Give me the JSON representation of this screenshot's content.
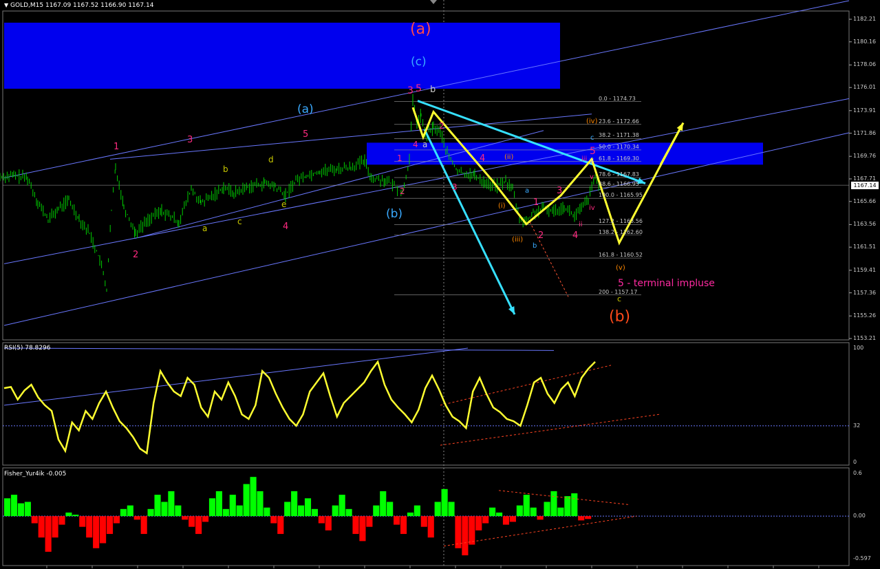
{
  "header": {
    "symbol_line": "GOLD,M15  1167.09 1167.52 1166.90 1167.14",
    "rsi_line": "RSI(5) 78.8296",
    "fisher_line": "Fisher_Yur4ik -0.005",
    "current_price": "1167.14"
  },
  "colors": {
    "up_candle": "#00d000",
    "rsi": "#ffff30",
    "fisher_up": "#00ff00",
    "fisher_down": "#ff0000",
    "zone": "#0000ee",
    "channel": "#6a78ff",
    "cyan_arrow": "#36e0ff",
    "yellow_path": "#ffff30"
  },
  "icons": {
    "menu": "triangle-down-icon",
    "scroll": "scroll-shift-icon"
  },
  "chart_data": [
    {
      "type": "candlestick",
      "symbol": "GOLD",
      "timeframe": "M15",
      "ohlc_last": {
        "open": 1167.09,
        "high": 1167.52,
        "low": 1166.9,
        "close": 1167.14
      },
      "yaxis_ticks": [
        "1182.21",
        "1180.16",
        "1178.06",
        "1176.01",
        "1173.91",
        "1171.86",
        "1169.76",
        "1167.71",
        "1165.66",
        "1163.56",
        "1161.51",
        "1159.41",
        "1157.36",
        "1155.26",
        "1153.21"
      ],
      "ylim": [
        1153.21,
        1182.21
      ],
      "price_path": [
        [
          0,
          1167.9
        ],
        [
          20,
          1168.0
        ],
        [
          40,
          1167.8
        ],
        [
          55,
          1165.6
        ],
        [
          70,
          1164.0
        ],
        [
          85,
          1165.0
        ],
        [
          100,
          1165.8
        ],
        [
          115,
          1164.1
        ],
        [
          130,
          1162.8
        ],
        [
          145,
          1160.4
        ],
        [
          155,
          1157.7
        ],
        [
          162,
          1164.8
        ],
        [
          168,
          1168.8
        ],
        [
          180,
          1165.2
        ],
        [
          197,
          1162.8
        ],
        [
          215,
          1164.0
        ],
        [
          235,
          1164.8
        ],
        [
          260,
          1163.8
        ],
        [
          278,
          1166.8
        ],
        [
          292,
          1165.5
        ],
        [
          310,
          1166.2
        ],
        [
          325,
          1167.0
        ],
        [
          340,
          1166.4
        ],
        [
          360,
          1167.0
        ],
        [
          385,
          1167.3
        ],
        [
          400,
          1167.0
        ],
        [
          415,
          1166.2
        ],
        [
          430,
          1167.6
        ],
        [
          445,
          1168.0
        ],
        [
          465,
          1168.4
        ],
        [
          490,
          1168.6
        ],
        [
          510,
          1168.8
        ],
        [
          530,
          1169.3
        ],
        [
          540,
          1167.8
        ],
        [
          560,
          1167.6
        ],
        [
          575,
          1167.0
        ],
        [
          585,
          1166.4
        ],
        [
          595,
          1169.5
        ],
        [
          600,
          1174.8
        ],
        [
          606,
          1172.8
        ],
        [
          612,
          1173.5
        ],
        [
          618,
          1171.6
        ],
        [
          630,
          1172.4
        ],
        [
          640,
          1172.0
        ],
        [
          650,
          1170.0
        ],
        [
          665,
          1168.4
        ],
        [
          690,
          1168.0
        ],
        [
          705,
          1167.4
        ],
        [
          720,
          1167.0
        ],
        [
          735,
          1167.5
        ],
        [
          745,
          1166.8
        ],
        [
          755,
          1164.1
        ],
        [
          765,
          1163.8
        ],
        [
          775,
          1164.6
        ],
        [
          790,
          1165.0
        ],
        [
          805,
          1164.8
        ],
        [
          820,
          1165.2
        ],
        [
          835,
          1164.3
        ],
        [
          845,
          1165.0
        ],
        [
          855,
          1165.9
        ],
        [
          865,
          1167.8
        ],
        [
          872,
          1167.1
        ]
      ],
      "fib_levels": [
        "0.0 - 1174.73",
        "23.6 - 1172.66",
        "38.2 - 1171.38",
        "50.0 - 1170.34",
        "61.8 - 1169.30",
        "78.6 - 1167.83",
        "88.6 - 1166.95",
        "100.0 - 1165.95",
        "127.2 - 1163.56",
        "138.2 - 1162.60",
        "161.8 - 1160.52",
        "200 - 1157.17"
      ],
      "annotations": {
        "big_a": "(a)",
        "big_c": "(c)",
        "big_b": "(b)",
        "paren_a": "(a)",
        "paren_b": "(b)",
        "terminal": "5 - terminal impluse",
        "wave_1": "1",
        "wave_2": "2",
        "wave_3": "3",
        "wave_4": "4",
        "wave_5": "5",
        "sub_a": "a",
        "sub_b": "b",
        "sub_c": "c",
        "sub_d": "d",
        "sub_e": "e",
        "top_3": "3",
        "top_5": "5",
        "top_b": "b",
        "top_4": "4",
        "top_a": "a",
        "top_2": "2",
        "b_1": "1",
        "b_2": "2",
        "d_3": "3",
        "d_4": "4",
        "iv_paren": "(iv)",
        "ii_paren": "(ii)",
        "i_paren": "(i)",
        "iii_paren": "(iii)",
        "v_paren": "(v)",
        "m_a": "a",
        "m_b": "b",
        "m_1": "1",
        "m_2": "2",
        "m_3": "3",
        "m_4": "4",
        "r_5": "5",
        "r_iii": "iii",
        "r_iv": "iv",
        "r_ii": "ii",
        "r_c": "c",
        "r_c2": "c",
        "r_v": "v",
        "r_y": "y"
      }
    },
    {
      "type": "line",
      "name": "RSI(5)",
      "ylim": [
        0,
        100
      ],
      "yaxis_ticks": [
        "100",
        "32",
        "0"
      ],
      "level": 32,
      "values": [
        65,
        66,
        55,
        63,
        68,
        57,
        50,
        45,
        20,
        10,
        35,
        28,
        45,
        38,
        52,
        62,
        48,
        36,
        30,
        22,
        12,
        8,
        52,
        80,
        70,
        62,
        58,
        74,
        68,
        48,
        40,
        62,
        55,
        70,
        58,
        42,
        38,
        50,
        80,
        74,
        60,
        48,
        38,
        32,
        42,
        62,
        70,
        78,
        58,
        40,
        52,
        58,
        64,
        70,
        80,
        88,
        68,
        55,
        48,
        42,
        35,
        46,
        65,
        76,
        64,
        50,
        40,
        36,
        30,
        62,
        74,
        60,
        48,
        44,
        38,
        36,
        32,
        50,
        70,
        74,
        60,
        52,
        64,
        70,
        58,
        74,
        82,
        88
      ]
    },
    {
      "type": "bar",
      "name": "Fisher_Yur4ik",
      "ylim": [
        -0.597,
        0.6
      ],
      "yaxis_ticks": [
        "0.6",
        "0.00",
        "-0.597"
      ],
      "values": [
        0.25,
        0.3,
        0.18,
        0.2,
        -0.1,
        -0.3,
        -0.5,
        -0.3,
        -0.12,
        0.05,
        0.02,
        -0.15,
        -0.3,
        -0.45,
        -0.38,
        -0.25,
        -0.1,
        0.1,
        0.15,
        -0.05,
        -0.25,
        0.1,
        0.3,
        0.2,
        0.35,
        0.15,
        -0.05,
        -0.15,
        -0.25,
        -0.08,
        0.25,
        0.35,
        0.1,
        0.3,
        0.15,
        0.45,
        0.55,
        0.35,
        0.12,
        -0.1,
        -0.25,
        0.2,
        0.35,
        0.15,
        0.25,
        0.1,
        -0.1,
        -0.2,
        0.15,
        0.3,
        0.1,
        -0.25,
        -0.35,
        -0.15,
        0.15,
        0.35,
        0.2,
        -0.12,
        -0.25,
        0.05,
        0.15,
        -0.15,
        -0.3,
        0.2,
        0.38,
        0.2,
        -0.45,
        -0.55,
        -0.4,
        -0.2,
        -0.1,
        0.12,
        0.05,
        -0.12,
        -0.08,
        0.15,
        0.3,
        0.12,
        -0.05,
        0.2,
        0.35,
        0.12,
        0.28,
        0.32,
        -0.06,
        -0.04
      ]
    }
  ]
}
